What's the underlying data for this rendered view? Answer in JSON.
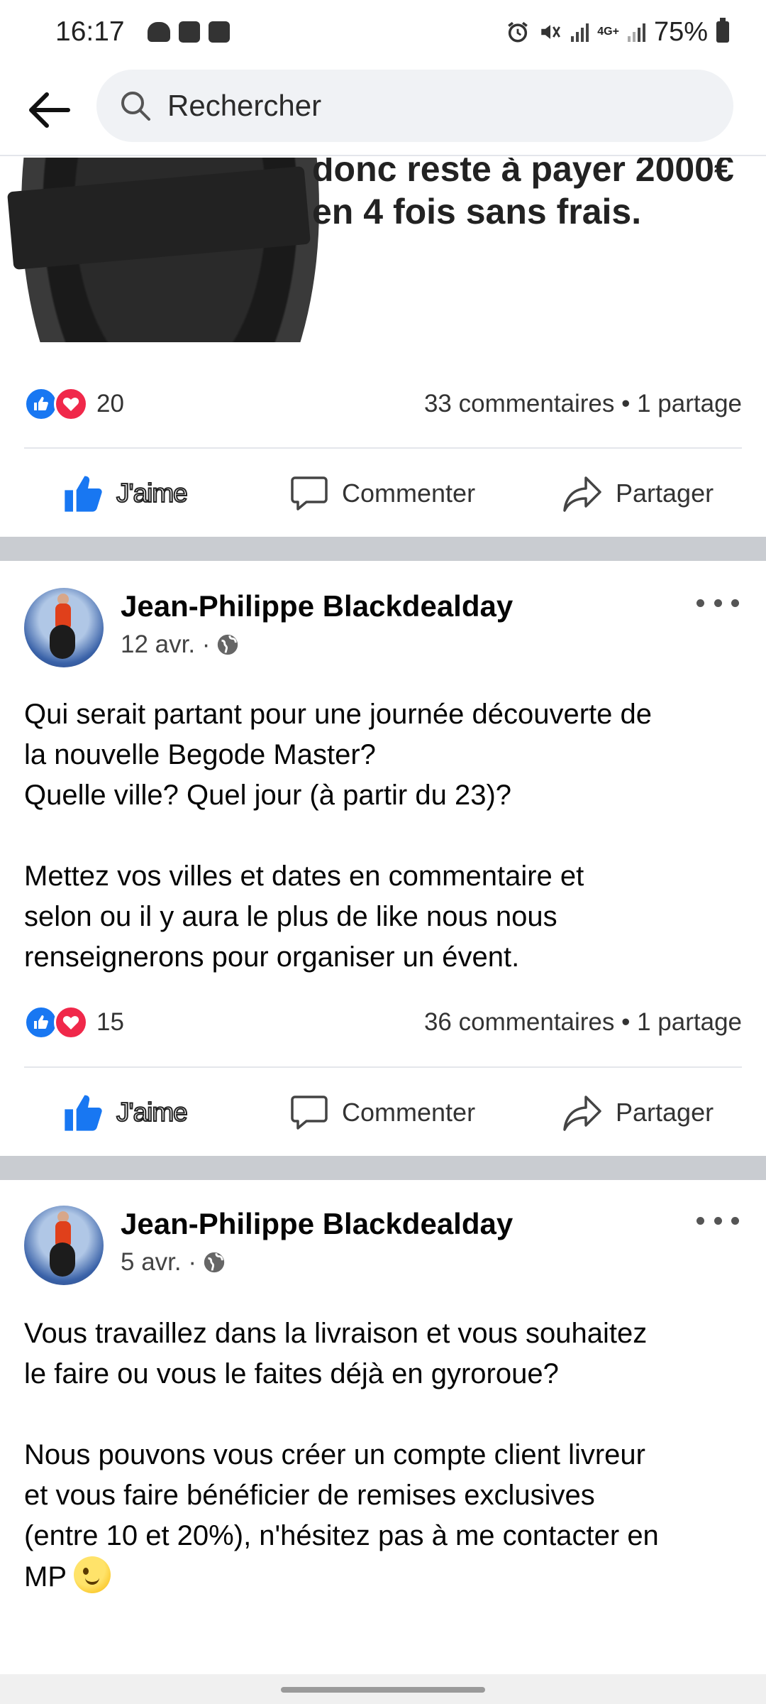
{
  "status_bar": {
    "time": "16:17",
    "network": "4G+",
    "battery": "75%"
  },
  "search": {
    "placeholder": "Rechercher"
  },
  "post_top": {
    "image_text": [
      "donc reste à payer 2000€",
      "en 4 fois sans frais."
    ],
    "reaction_count": "20",
    "stats": "33 commentaires • 1 partage"
  },
  "actions": {
    "like": "J'aime",
    "comment": "Commenter",
    "share": "Partager"
  },
  "post_2": {
    "author": "Jean-Philippe Blackdealday",
    "date": "12 avr. ·",
    "text": "Qui serait partant pour une journée découverte de\nla nouvelle Begode Master?\nQuelle ville? Quel jour (à partir du 23)?\n\nMettez vos villes et dates en commentaire et\nselon ou il y aura le plus de like nous nous\nrenseignerons pour organiser un évent.",
    "reaction_count": "15",
    "stats": "36 commentaires • 1 partage"
  },
  "post_3": {
    "author": "Jean-Philippe Blackdealday",
    "date": "5 avr. ·",
    "text": "Vous travaillez dans la livraison et vous souhaitez\nle faire ou vous le faites déjà en gyroroue?\n\nNous pouvons vous créer un compte client livreur\net vous faire bénéficier de remises exclusives\n(entre 10 et 20%), n'hésitez pas à me contacter en\nMP "
  },
  "colors": {
    "like_blue": "#1877f2",
    "love_red": "#f0284a",
    "separator": "#c9ccd1",
    "search_bg": "#f0f2f5"
  },
  "icons": [
    "back-arrow-icon",
    "search-icon",
    "like-reaction-icon",
    "love-reaction-icon",
    "thumbs-up-icon",
    "comment-icon",
    "share-icon",
    "globe-icon",
    "more-icon",
    "wink-emoji-icon"
  ]
}
